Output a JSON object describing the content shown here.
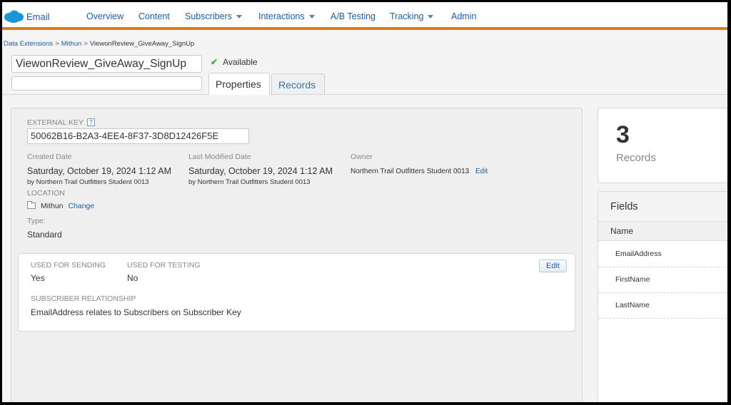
{
  "nav": {
    "app_name": "Email",
    "items": [
      {
        "label": "Overview",
        "dropdown": false
      },
      {
        "label": "Content",
        "dropdown": false
      },
      {
        "label": "Subscribers",
        "dropdown": true
      },
      {
        "label": "Interactions",
        "dropdown": true
      },
      {
        "label": "A/B Testing",
        "dropdown": false
      },
      {
        "label": "Tracking",
        "dropdown": true
      },
      {
        "label": "Admin",
        "dropdown": false
      }
    ],
    "accent_color": "#e07c17",
    "brand_color": "#1797d6"
  },
  "breadcrumb": {
    "items": [
      "Data Extensions",
      "Mithun",
      "ViewonReview_GiveAway_SignUp"
    ],
    "separator": ">"
  },
  "header": {
    "name_value": "ViewonReview_GiveAway_SignUp",
    "description_value": "",
    "status": "Available",
    "status_icon": "checkmark-icon"
  },
  "tabs": [
    {
      "label": "Properties",
      "active": true
    },
    {
      "label": "Records",
      "active": false
    }
  ],
  "properties": {
    "external_key_label": "EXTERNAL KEY",
    "help_glyph": "?",
    "external_key": "50062B16-B2A3-4EE4-8F37-3D8D12426F5E",
    "created_date_label": "Created Date",
    "created_date": "Saturday, October 19, 2024 1:12 AM",
    "created_by": "by Northern Trail Outfitters Student 0013",
    "modified_date_label": "Last Modified Date",
    "modified_date": "Saturday, October 19, 2024 1:12 AM",
    "modified_by": "by Northern Trail Outfitters Student 0013",
    "owner_label": "Owner",
    "owner": "Northern Trail Outfitters Student 0013",
    "owner_edit": "Edit",
    "location_label": "LOCATION",
    "location": "Mithun",
    "location_change": "Change",
    "type_label": "Type:",
    "type": "Standard"
  },
  "settings": {
    "used_for_sending_label": "USED FOR SENDING",
    "used_for_sending": "Yes",
    "used_for_testing_label": "USED FOR TESTING",
    "used_for_testing": "No",
    "edit_label": "Edit",
    "relationship_label": "SUBSCRIBER RELATIONSHIP",
    "relationship": "EmailAddress relates to Subscribers on Subscriber Key"
  },
  "records": {
    "count": "3",
    "label": "Records"
  },
  "fields": {
    "title": "Fields",
    "column_name": "Name",
    "rows": [
      "EmailAddress",
      "FirstName",
      "LastName"
    ]
  }
}
